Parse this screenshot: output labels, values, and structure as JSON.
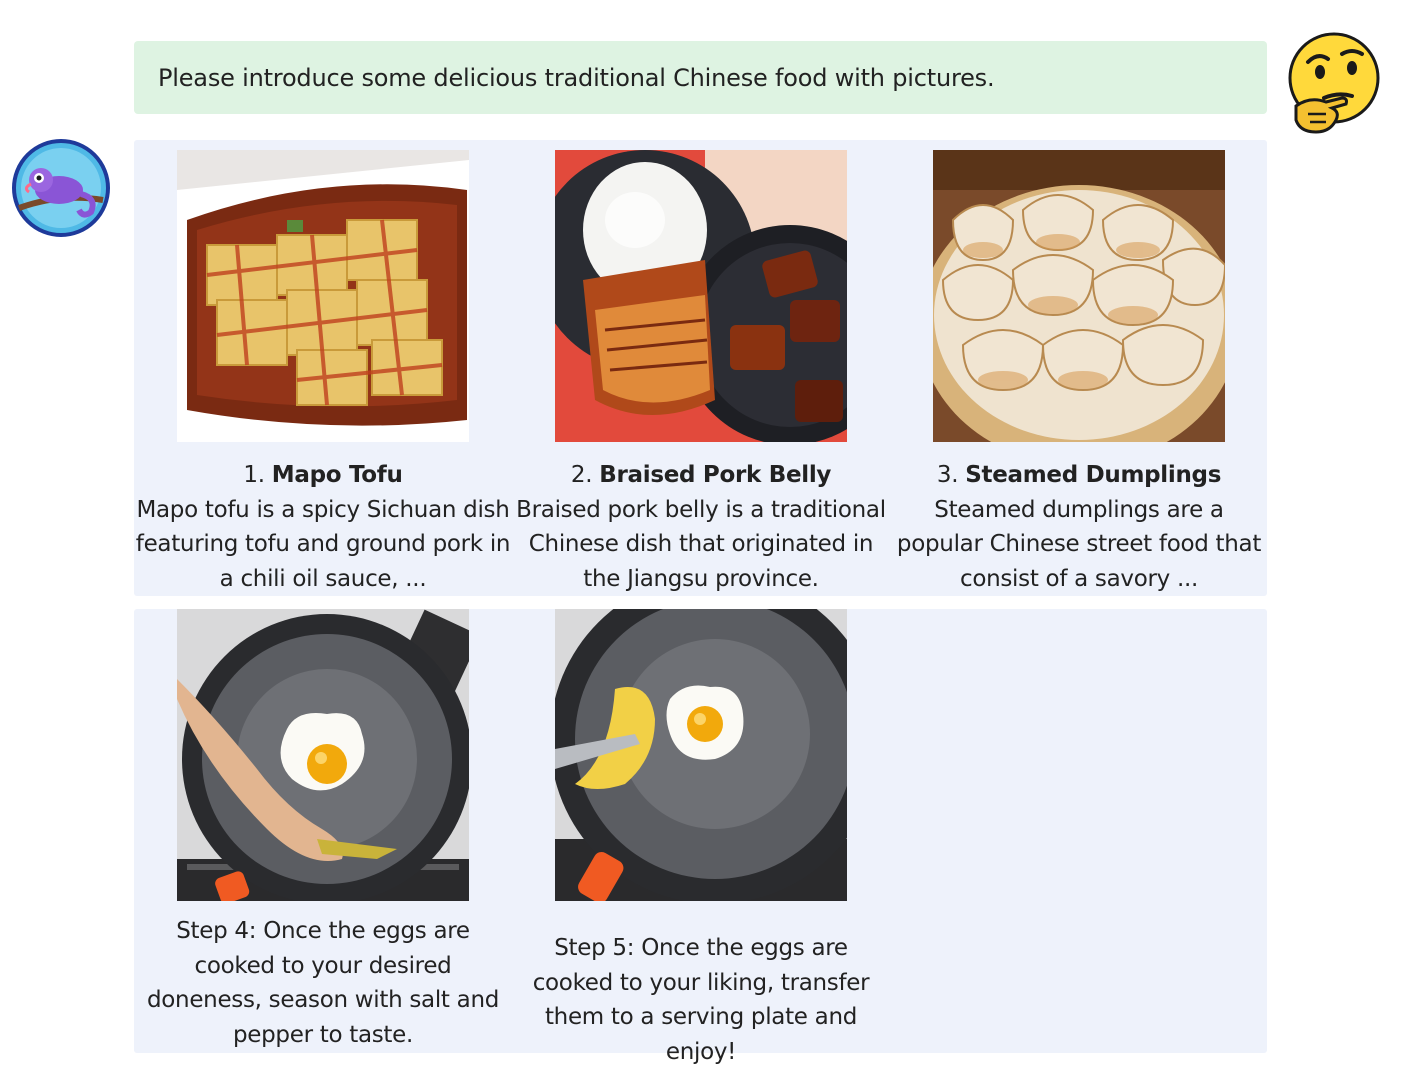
{
  "prompt": {
    "text": "Please introduce some delicious traditional Chinese food with pictures."
  },
  "avatars": {
    "user_icon": "thinking-face-emoji",
    "assistant_icon": "chameleon-avatar"
  },
  "dishes": [
    {
      "number": "1.",
      "name": "Mapo Tofu",
      "description": "Mapo tofu is a spicy Sichuan dish featuring tofu and ground pork in a chili oil sauce, ..."
    },
    {
      "number": "2.",
      "name": "Braised Pork Belly",
      "description": "Braised pork belly is a traditional Chinese dish that originated in the Jiangsu province."
    },
    {
      "number": "3.",
      "name": "Steamed Dumplings",
      "description": "Steamed dumplings are a popular Chinese street food that consist of a savory ..."
    }
  ],
  "steps": [
    {
      "text": "Step 4: Once the eggs are cooked to your desired doneness, season with salt and pepper to taste."
    },
    {
      "text": "Step 5: Once the eggs are cooked to your liking, transfer them to a serving plate and enjoy!"
    }
  ],
  "colors": {
    "prompt_bg": "#def3e2",
    "panel_bg": "#eef2fb"
  }
}
